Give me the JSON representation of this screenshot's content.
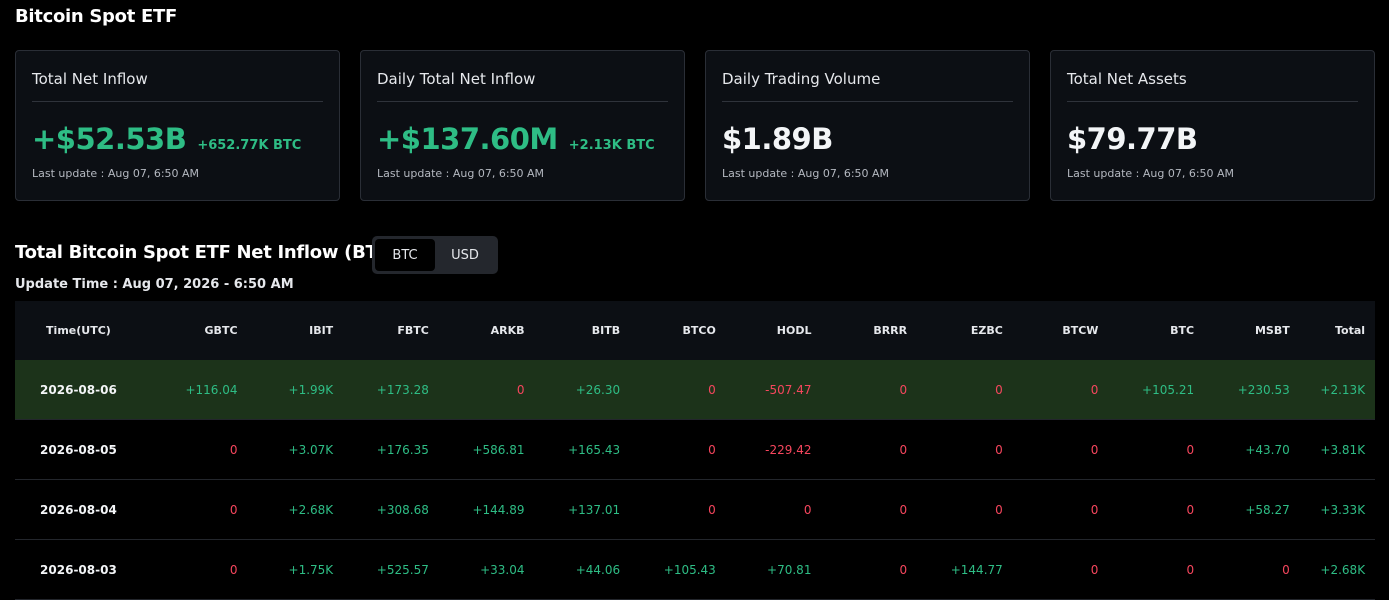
{
  "page_title": "Bitcoin Spot ETF",
  "cards": [
    {
      "title": "Total Net Inflow",
      "value": "+$52.53B",
      "sub": "+652.77K BTC",
      "update": "Last update : Aug 07, 6:50 AM",
      "value_color": "green"
    },
    {
      "title": "Daily Total Net Inflow",
      "value": "+$137.60M",
      "sub": "+2.13K BTC",
      "update": "Last update : Aug 07, 6:50 AM",
      "value_color": "green"
    },
    {
      "title": "Daily Trading Volume",
      "value": "$1.89B",
      "sub": "",
      "update": "Last update : Aug 07, 6:50 AM",
      "value_color": "white"
    },
    {
      "title": "Total Net Assets",
      "value": "$79.77B",
      "sub": "",
      "update": "Last update : Aug 07, 6:50 AM",
      "value_color": "white"
    }
  ],
  "section_title": "Total Bitcoin Spot ETF Net Inflow (BTC)",
  "toggle": {
    "btc": "BTC",
    "usd": "USD",
    "active": "BTC"
  },
  "update_time": "Update Time : Aug 07, 2026 - 6:50 AM",
  "table": {
    "headers": [
      "Time(UTC)",
      "GBTC",
      "IBIT",
      "FBTC",
      "ARKB",
      "BITB",
      "BTCO",
      "HODL",
      "BRRR",
      "EZBC",
      "BTCW",
      "BTC",
      "MSBT",
      "Total"
    ],
    "rows": [
      [
        "2026-08-06",
        "+116.04",
        "+1.99K",
        "+173.28",
        "0",
        "+26.30",
        "0",
        "-507.47",
        "0",
        "0",
        "0",
        "+105.21",
        "+230.53",
        "+2.13K"
      ],
      [
        "2026-08-05",
        "0",
        "+3.07K",
        "+176.35",
        "+586.81",
        "+165.43",
        "0",
        "-229.42",
        "0",
        "0",
        "0",
        "0",
        "+43.70",
        "+3.81K"
      ],
      [
        "2026-08-04",
        "0",
        "+2.68K",
        "+308.68",
        "+144.89",
        "+137.01",
        "0",
        "0",
        "0",
        "0",
        "0",
        "0",
        "+58.27",
        "+3.33K"
      ],
      [
        "2026-08-03",
        "0",
        "+1.75K",
        "+525.57",
        "+33.04",
        "+44.06",
        "+105.43",
        "+70.81",
        "0",
        "+144.77",
        "0",
        "0",
        "0",
        "+2.68K"
      ]
    ]
  },
  "colors": {
    "positive": "#2ebd85",
    "negative": "#f6465d",
    "highlight_row": "#1c331a"
  }
}
